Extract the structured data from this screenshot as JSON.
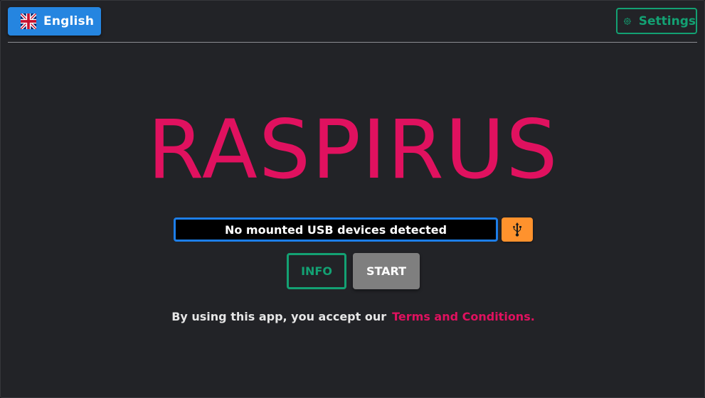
{
  "header": {
    "language_label": "English",
    "language_flag": "uk-flag-icon",
    "settings_label": "Settings",
    "settings_icon": "gear-icon"
  },
  "main": {
    "app_title": "RASPIRUS",
    "usb_select_value": "No mounted USB devices detected",
    "usb_button_icon": "usb-icon",
    "info_label": "INFO",
    "start_label": "START",
    "terms_text": "By using this app, you accept our",
    "terms_link": "Terms and Conditions."
  },
  "colors": {
    "background": "#222327",
    "title": "#e0115f",
    "language_button": "#2585e0",
    "settings_accent": "#13a173",
    "usb_select_border": "#1d7ee8",
    "usb_button": "#ff922d",
    "start_button": "#7f7f7f",
    "link": "#e0115f"
  }
}
